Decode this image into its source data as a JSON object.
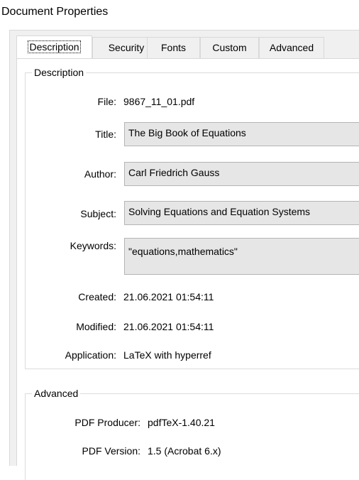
{
  "window": {
    "title": "Document Properties"
  },
  "tabs": [
    "Description",
    "Security",
    "Fonts",
    "Custom",
    "Advanced"
  ],
  "description": {
    "group_title": "Description",
    "file_label": "File:",
    "file_value": "9867_11_01.pdf",
    "title_label": "Title:",
    "title_value": "The Big Book of Equations",
    "author_label": "Author:",
    "author_value": "Carl Friedrich Gauss",
    "subject_label": "Subject:",
    "subject_value": "Solving Equations and Equation Systems",
    "keywords_label": "Keywords:",
    "keywords_value": "\"equations,mathematics\"",
    "created_label": "Created:",
    "created_value": "21.06.2021 01:54:11",
    "modified_label": "Modified:",
    "modified_value": "21.06.2021 01:54:11",
    "application_label": "Application:",
    "application_value": "LaTeX with hyperref"
  },
  "advanced": {
    "group_title": "Advanced",
    "producer_label": "PDF Producer:",
    "producer_value": "pdfTeX-1.40.21",
    "version_label": "PDF Version:",
    "version_value": "1.5 (Acrobat 6.x)"
  }
}
